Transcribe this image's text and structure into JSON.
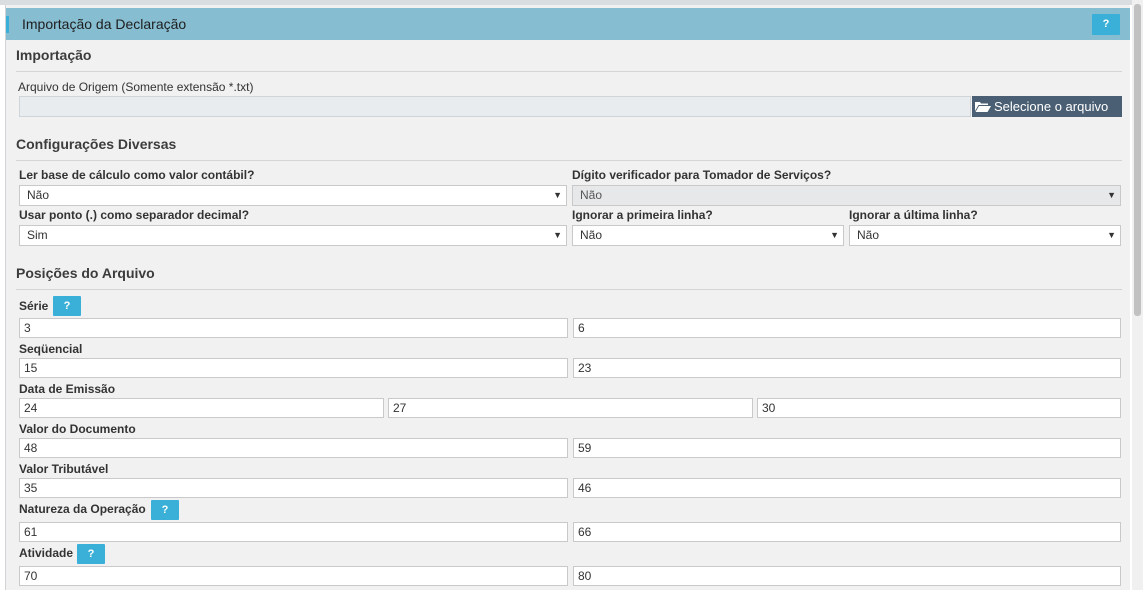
{
  "header": {
    "title": "Importação da Declaração",
    "help": "?"
  },
  "importacao": {
    "section_title": "Importação",
    "file_label": "Arquivo de Origem (Somente extensão *.txt)",
    "file_value": "",
    "select_button": "Selecione o arquivo"
  },
  "config": {
    "section_title": "Configurações Diversas",
    "ler_base": {
      "label": "Ler base de cálculo como valor contábil?",
      "value": "Não"
    },
    "digito": {
      "label": "Dígito verificador para Tomador de Serviços?",
      "value": "Não"
    },
    "usar_ponto": {
      "label": "Usar ponto (.) como separador decimal?",
      "value": "Sim"
    },
    "ignorar_primeira": {
      "label": "Ignorar a primeira linha?",
      "value": "Não"
    },
    "ignorar_ultima": {
      "label": "Ignorar a última linha?",
      "value": "Não"
    }
  },
  "posicoes": {
    "section_title": "Posições do Arquivo",
    "help": "?",
    "serie": {
      "label": "Série",
      "values": [
        "3",
        "6"
      ]
    },
    "sequencial": {
      "label": "Seqüencial",
      "values": [
        "15",
        "23"
      ]
    },
    "data_emissao": {
      "label": "Data de Emissão",
      "values": [
        "24",
        "27",
        "30"
      ]
    },
    "valor_documento": {
      "label": "Valor do Documento",
      "values": [
        "48",
        "59"
      ]
    },
    "valor_tributavel": {
      "label": "Valor Tributável",
      "values": [
        "35",
        "46"
      ]
    },
    "natureza": {
      "label": "Natureza da Operação",
      "values": [
        "61",
        "66"
      ]
    },
    "atividade": {
      "label": "Atividade",
      "values": [
        "70",
        "80"
      ]
    }
  },
  "icons": {
    "select_arrow": "▼",
    "folder": "folder-open-icon"
  },
  "colors": {
    "header_bg": "#86bdd0",
    "help_bg": "#3ab0d8",
    "button_bg": "#4a5f73"
  }
}
